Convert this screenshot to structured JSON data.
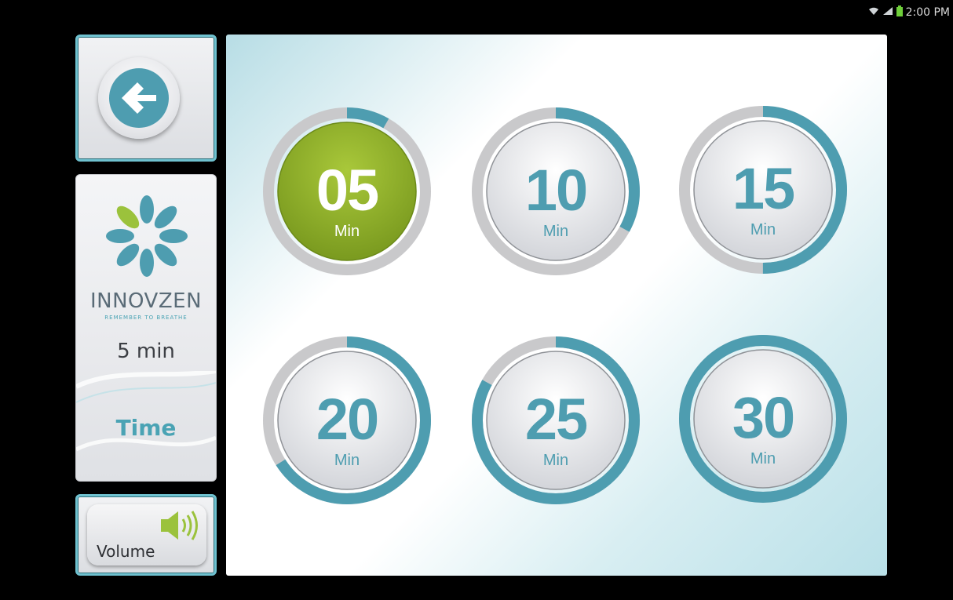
{
  "status_bar": {
    "time": "2:00 PM"
  },
  "back_button": {
    "icon": "arrow-left-icon"
  },
  "brand": {
    "name": "INNOVZEN",
    "tagline": "REMEMBER TO BREATHE"
  },
  "info": {
    "selected_time": "5 min",
    "section_label": "Time"
  },
  "volume": {
    "label": "Volume",
    "icon": "speaker-icon"
  },
  "colors": {
    "accent": "#4e9db0",
    "selected": "#8bab2a",
    "ring_track": "#c9c9cb",
    "panel_border": "#6fc1cf"
  },
  "timers": [
    {
      "value": "05",
      "unit": "Min",
      "selected": true,
      "progress": 0.083
    },
    {
      "value": "10",
      "unit": "Min",
      "selected": false,
      "progress": 0.33
    },
    {
      "value": "15",
      "unit": "Min",
      "selected": false,
      "progress": 0.5
    },
    {
      "value": "20",
      "unit": "Min",
      "selected": false,
      "progress": 0.66
    },
    {
      "value": "25",
      "unit": "Min",
      "selected": false,
      "progress": 0.83
    },
    {
      "value": "30",
      "unit": "Min",
      "selected": false,
      "progress": 1.0
    }
  ]
}
